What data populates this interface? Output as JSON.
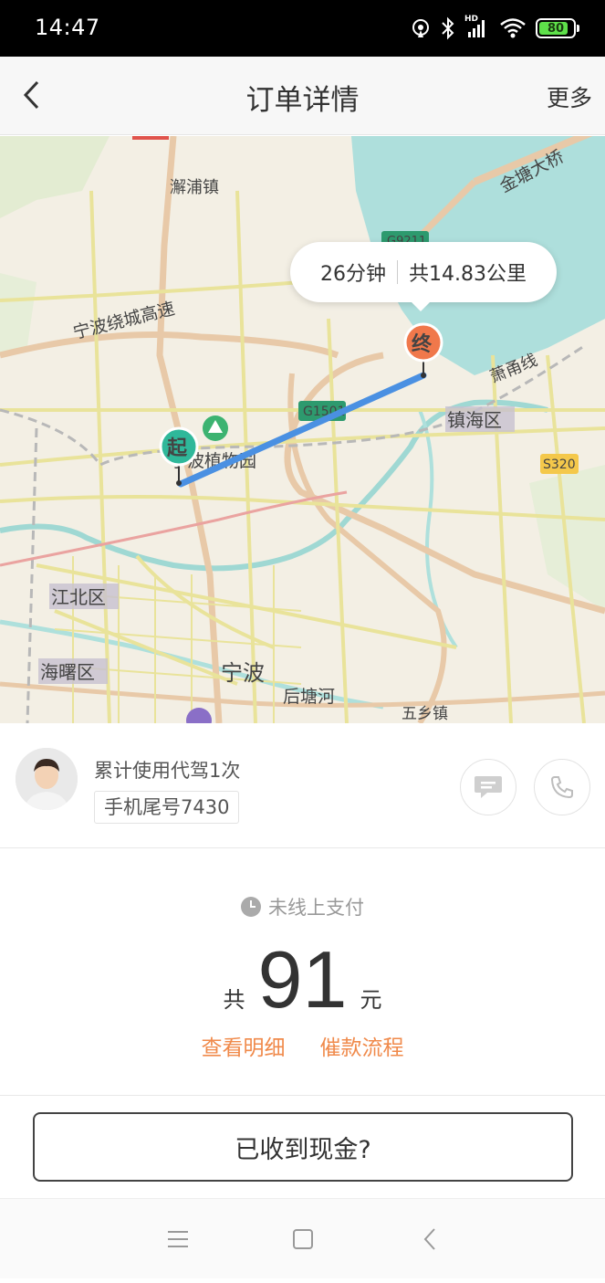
{
  "status_bar": {
    "time": "14:47",
    "battery": "80",
    "signal_label": "HD"
  },
  "nav": {
    "title": "订单详情",
    "more": "更多"
  },
  "map": {
    "route_summary": {
      "duration": "26分钟",
      "distance": "共14.83公里"
    },
    "start_marker": "起",
    "end_marker": "终",
    "labels": {
      "xiepu": "澥浦镇",
      "jintang": "金塘大桥",
      "g9211": "G9211",
      "ring_expressway": "宁波绕城高速",
      "xiaoyong": "萧甬线",
      "g1501": "G1501",
      "zhenhai": "镇海区",
      "s320": "S320",
      "botanical": "宁波植物园",
      "jiangbei": "江北区",
      "haishu": "海曙区",
      "ningbo": "宁波",
      "houtang": "后塘河",
      "wuxiang": "五乡镇"
    },
    "colors": {
      "route": "#4a90e2",
      "start": "#2fb89a",
      "end": "#f0784b",
      "water": "#aedfdc",
      "land": "#f3efe4"
    }
  },
  "driver": {
    "usage": "累计使用代驾1次",
    "phone_tail": "手机尾号7430"
  },
  "payment": {
    "status": "未线上支付",
    "prefix": "共",
    "amount": "91",
    "unit": "元",
    "detail_link": "查看明细",
    "collection_link": "催款流程",
    "link_color": "#f08a4b"
  },
  "actions": {
    "cash_received": "已收到现金?"
  }
}
